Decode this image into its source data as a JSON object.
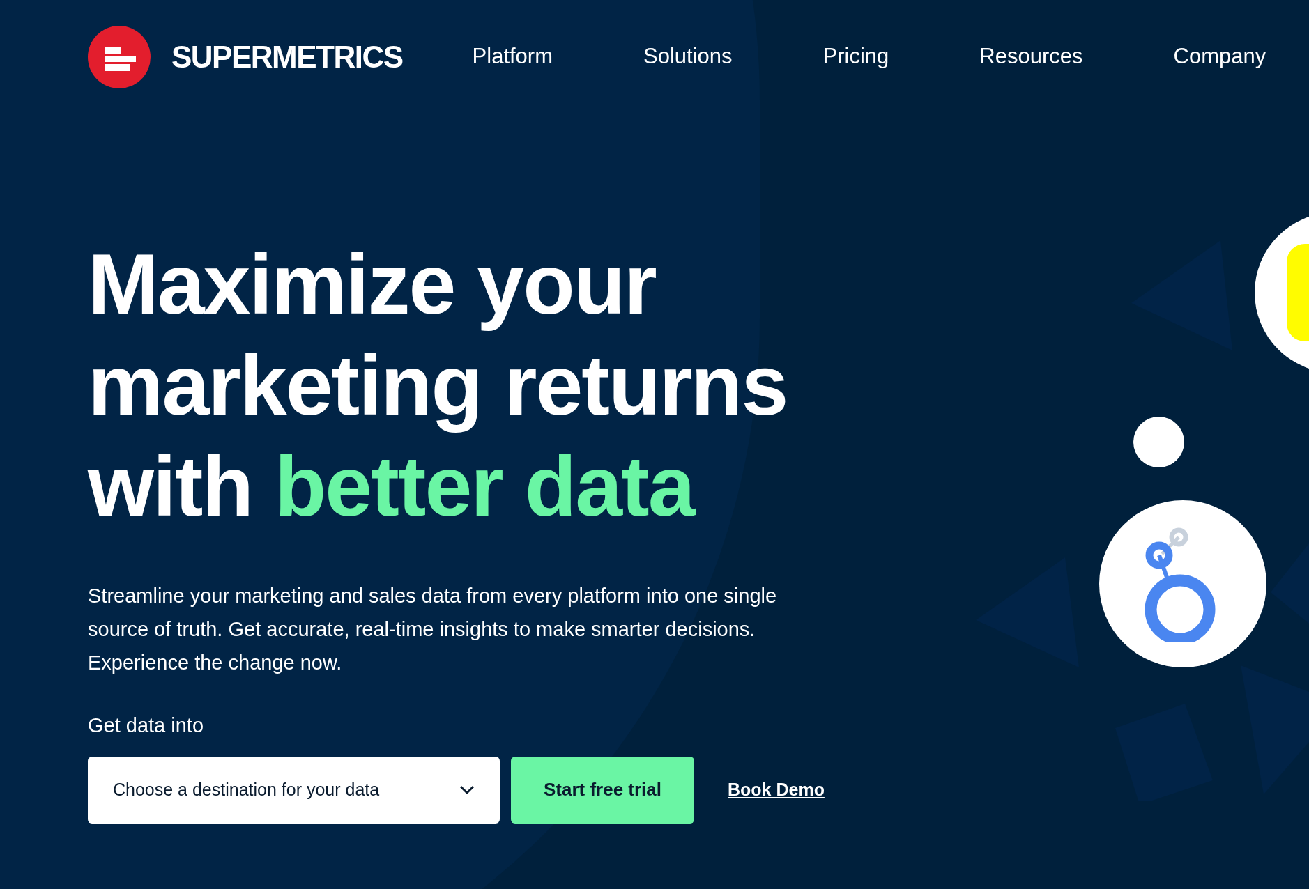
{
  "nav": {
    "brand": "SUPERMETRICS",
    "items": [
      "Platform",
      "Solutions",
      "Pricing",
      "Resources",
      "Company"
    ]
  },
  "hero": {
    "headline": [
      [
        {
          "text": "Maximize your",
          "highlight": false
        }
      ],
      [
        {
          "text": "marketing returns",
          "highlight": false
        }
      ],
      [
        {
          "text": "with ",
          "highlight": false
        },
        {
          "text": "better data",
          "highlight": true
        }
      ]
    ],
    "description": "Streamline your marketing and sales data from every platform into one single source of truth. Get accurate, real-time insights to make smarter decisions. Experience the change now.",
    "select_label": "Get data into",
    "select": {
      "placeholder": "Choose a destination for your data"
    },
    "primary_button": "Start free trial",
    "link": "Book Demo"
  }
}
